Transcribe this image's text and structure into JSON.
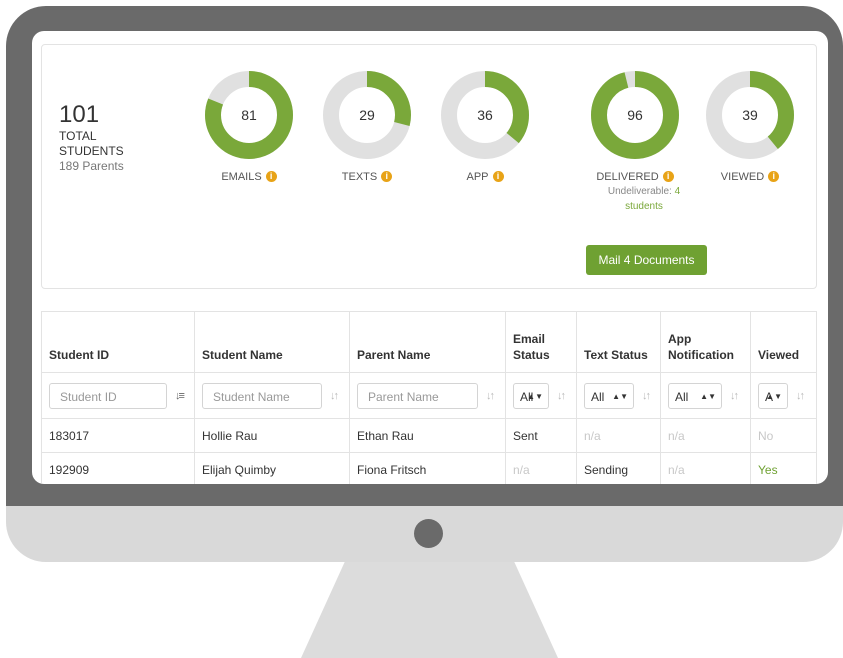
{
  "summary": {
    "total_number": "101",
    "total_label": "TOTAL STUDENTS",
    "parents": "189 Parents"
  },
  "metrics": {
    "emails": {
      "value": "81",
      "label": "EMAILS",
      "fraction": 0.81
    },
    "texts": {
      "value": "29",
      "label": "TEXTS",
      "fraction": 0.29
    },
    "app": {
      "value": "36",
      "label": "APP",
      "fraction": 0.36
    },
    "delivered": {
      "value": "96",
      "label": "DELIVERED",
      "fraction": 0.96
    },
    "viewed": {
      "value": "39",
      "label": "VIEWED",
      "fraction": 0.39
    }
  },
  "undeliverable": {
    "prefix": "Undeliverable:",
    "count": "4",
    "unit": "students"
  },
  "mail_button": "Mail 4 Documents",
  "table": {
    "headers": {
      "student_id": "Student ID",
      "student_name": "Student Name",
      "parent_name": "Parent Name",
      "email_status": "Email Status",
      "text_status": "Text Status",
      "app_notification": "App Notification",
      "viewed": "Viewed"
    },
    "filters": {
      "student_id_placeholder": "Student ID",
      "student_name_placeholder": "Student Name",
      "parent_name_placeholder": "Parent Name",
      "email_status": "All",
      "text_status": "All",
      "app_notification": "All",
      "viewed": "A"
    },
    "rows": [
      {
        "student_id": "183017",
        "student_name": "Hollie Rau",
        "parent_name": "Ethan Rau",
        "email_status": "Sent",
        "text_status": "n/a",
        "app_notification": "n/a",
        "viewed": "No"
      },
      {
        "student_id": "192909",
        "student_name": "Elijah Quimby",
        "parent_name": "Fiona Fritsch",
        "email_status": "n/a",
        "text_status": "Sending",
        "app_notification": "n/a",
        "viewed": "Yes"
      }
    ]
  },
  "colors": {
    "accent_green": "#7aa83a",
    "ring_track": "#e0e0e0",
    "info_icon": "#e8a317",
    "button_green": "#6fa132"
  },
  "icons": {
    "info": "info-circle-icon",
    "sort": "sort-arrows-icon",
    "select": "select-arrows-icon"
  }
}
